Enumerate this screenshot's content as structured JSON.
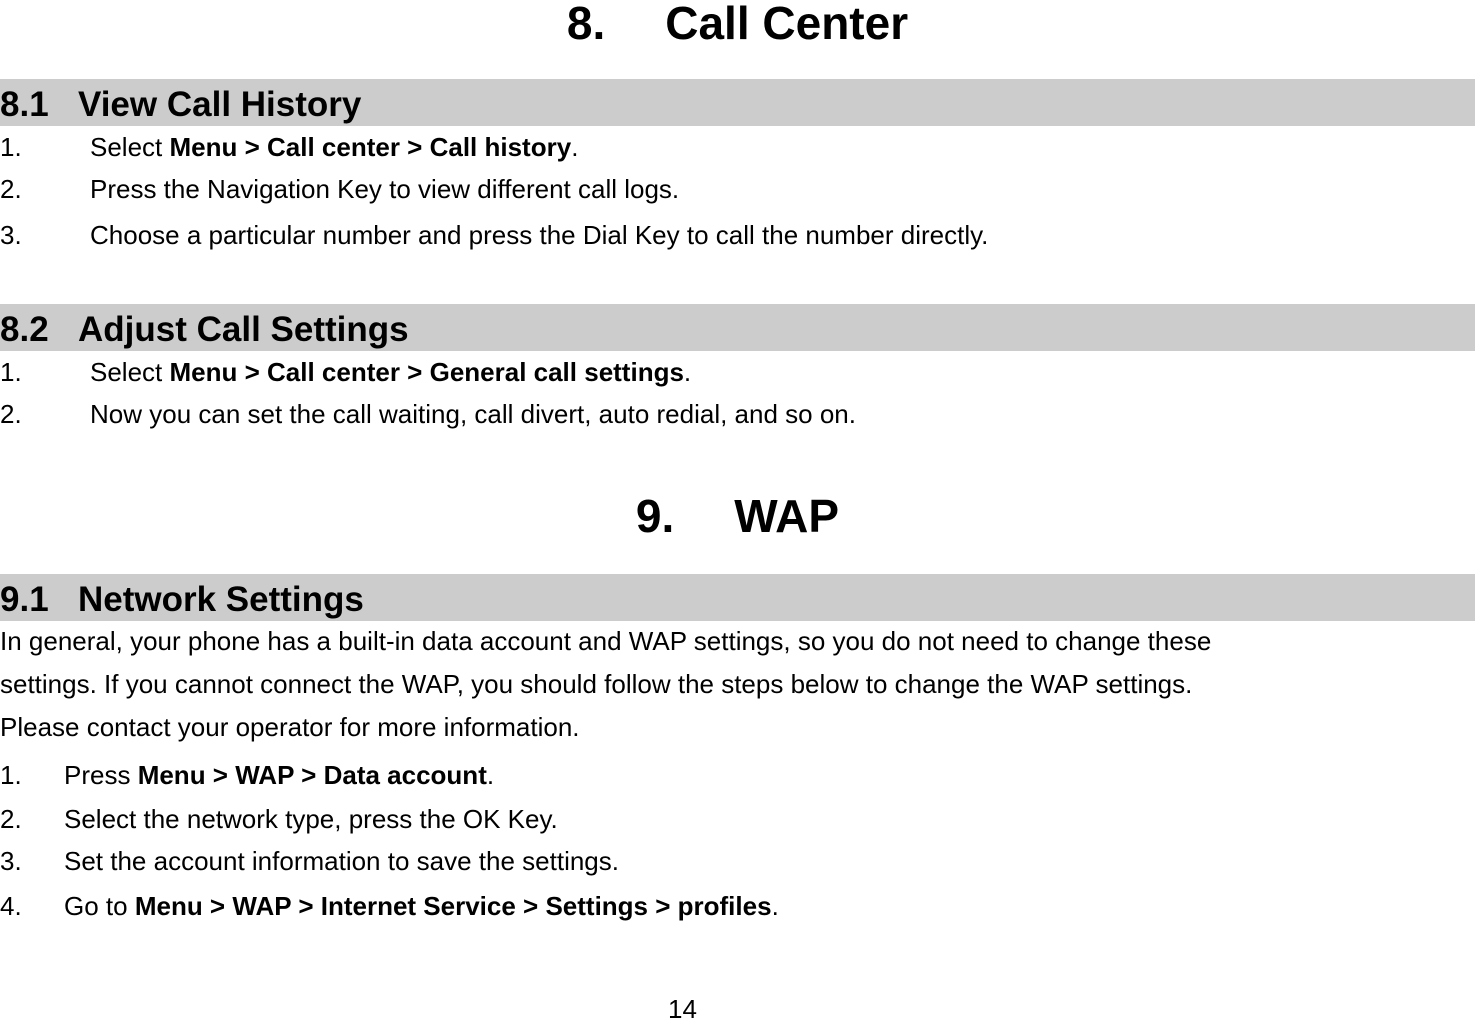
{
  "chapters": [
    {
      "number": "8.",
      "title": "Call Center",
      "sections": [
        {
          "number": "8.1",
          "title": "View Call History",
          "steps": [
            {
              "num": "1.",
              "prefix": "Select ",
              "bold": "Menu > Call center > Call history",
              "suffix": "."
            },
            {
              "num": "2.",
              "prefix": "Press the Navigation Key to view different call logs.",
              "bold": "",
              "suffix": ""
            },
            {
              "num": "3.",
              "prefix": "Choose a particular number and press the Dial Key to call the number directly.",
              "bold": "",
              "suffix": ""
            }
          ]
        },
        {
          "number": "8.2",
          "title": "Adjust Call Settings",
          "steps": [
            {
              "num": "1.",
              "prefix": "Select ",
              "bold": "Menu > Call center > General call settings",
              "suffix": "."
            },
            {
              "num": "2.",
              "prefix": "Now you can set the call waiting, call divert, auto redial, and so on.",
              "bold": "",
              "suffix": ""
            }
          ]
        }
      ]
    },
    {
      "number": "9.",
      "title": "WAP",
      "sections": [
        {
          "number": "9.1",
          "title": "Network Settings",
          "paragraph_lines": [
            "In general, your phone has a built-in data account and WAP settings, so you do not need to change these",
            "settings. If you cannot connect the WAP, you should follow the steps below to change the WAP settings.",
            "Please contact your operator for more information."
          ],
          "steps": [
            {
              "num": "1.",
              "prefix": "Press ",
              "bold": "Menu > WAP > Data account",
              "suffix": "."
            },
            {
              "num": "2.",
              "prefix": "Select the network type, press the OK Key.",
              "bold": "",
              "suffix": ""
            },
            {
              "num": "3.",
              "prefix": "Set the account information to save the settings.",
              "bold": "",
              "suffix": ""
            },
            {
              "num": "4.",
              "prefix": "Go to ",
              "bold": "Menu > WAP > Internet Service > Settings > profiles",
              "suffix": "."
            }
          ]
        }
      ]
    }
  ],
  "page_number": "14",
  "colors": {
    "section_bar": "#cccccc",
    "text": "#000000",
    "background": "#ffffff"
  }
}
